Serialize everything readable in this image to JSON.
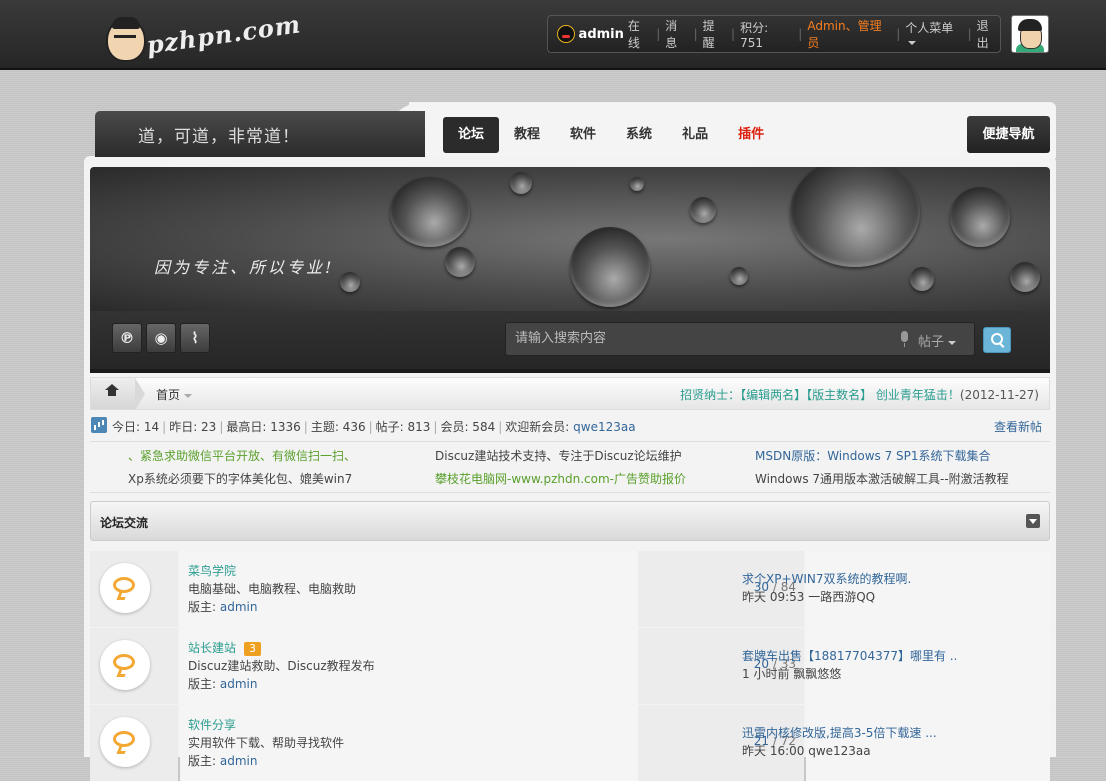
{
  "logo": {
    "text": "pzhpn.com"
  },
  "userbar": {
    "username": "admin",
    "status": "在线",
    "messages": "消息",
    "reminders": "提醒",
    "points": "积分: 751",
    "role": "Admin、管理员",
    "personal_menu": "个人菜单",
    "logout": "退出"
  },
  "slogan": "道，可道，非常道！",
  "nav": {
    "tabs": [
      "论坛",
      "教程",
      "软件",
      "系统",
      "礼品",
      "插件"
    ],
    "active": "论坛",
    "quick_nav": "便捷导航"
  },
  "banner": {
    "text": "因为专注、所以专业!"
  },
  "search": {
    "placeholder": "请输入搜索内容",
    "type": "帖子"
  },
  "breadcrumb": {
    "home": "首页",
    "right_text": "招贤纳士：【编辑两名】【版主数名】 创业青年猛击！",
    "date": "(2012-11-27)"
  },
  "stats": {
    "today": "今日: 14",
    "yesterday": "昨日: 23",
    "highest": "最高日: 1336",
    "topics": "主题: 436",
    "posts": "帖子: 813",
    "members": "会员: 584",
    "welcome_label": "欢迎新会员:",
    "new_member": "qwe123aa",
    "view_new": "查看新帖"
  },
  "announcements": [
    {
      "text": "、紧急求助微信平台开放、有微信扫一扫、",
      "color": "#5aa02c"
    },
    {
      "text": "Xp系统必须要下的字体美化包、媲美win7",
      "color": "#444444"
    },
    {
      "text": "Discuz建站技术支持、专注于Discuz论坛维护",
      "color": "#444444"
    },
    {
      "text": "攀枝花电脑网-www.pzhdn.com-广告赞助报价",
      "color": "#5aa02c"
    },
    {
      "text": "MSDN原版：Windows 7 SP1系统下载集合",
      "color": "#336699"
    },
    {
      "text": "Windows 7通用版本激活破解工具--附激活教程",
      "color": "#444444"
    }
  ],
  "category": {
    "title": "论坛交流"
  },
  "forums": [
    {
      "name": "菜鸟学院",
      "badge": "",
      "desc": "电脑基础、电脑教程、电脑救助",
      "mod_label": "版主:",
      "mod": "admin",
      "threads": "30",
      "posts": "84",
      "last_title": "求个XP+WIN7双系统的教程啊.",
      "last_meta": "昨天 09:53 一路西游QQ"
    },
    {
      "name": "站长建站",
      "badge": "3",
      "desc": "Discuz建站救助、Discuz教程发布",
      "mod_label": "版主:",
      "mod": "admin",
      "threads": "20",
      "posts": "33",
      "last_title": "套牌车出售【18817704377】哪里有 ...",
      "last_meta": "1 小时前 飘飘悠悠"
    },
    {
      "name": "软件分享",
      "badge": "",
      "desc": "实用软件下载、帮助寻找软件",
      "mod_label": "版主:",
      "mod": "admin",
      "threads": "21",
      "posts": "72",
      "last_title": "迅雷内核修改版,提高3-5倍下载速 ...",
      "last_meta": "昨天 16:00 qwe123aa"
    }
  ],
  "colors": {
    "accent": "#2a9d8f",
    "link": "#336699",
    "admin": "#f67e1f",
    "badge": "#f0a020"
  }
}
